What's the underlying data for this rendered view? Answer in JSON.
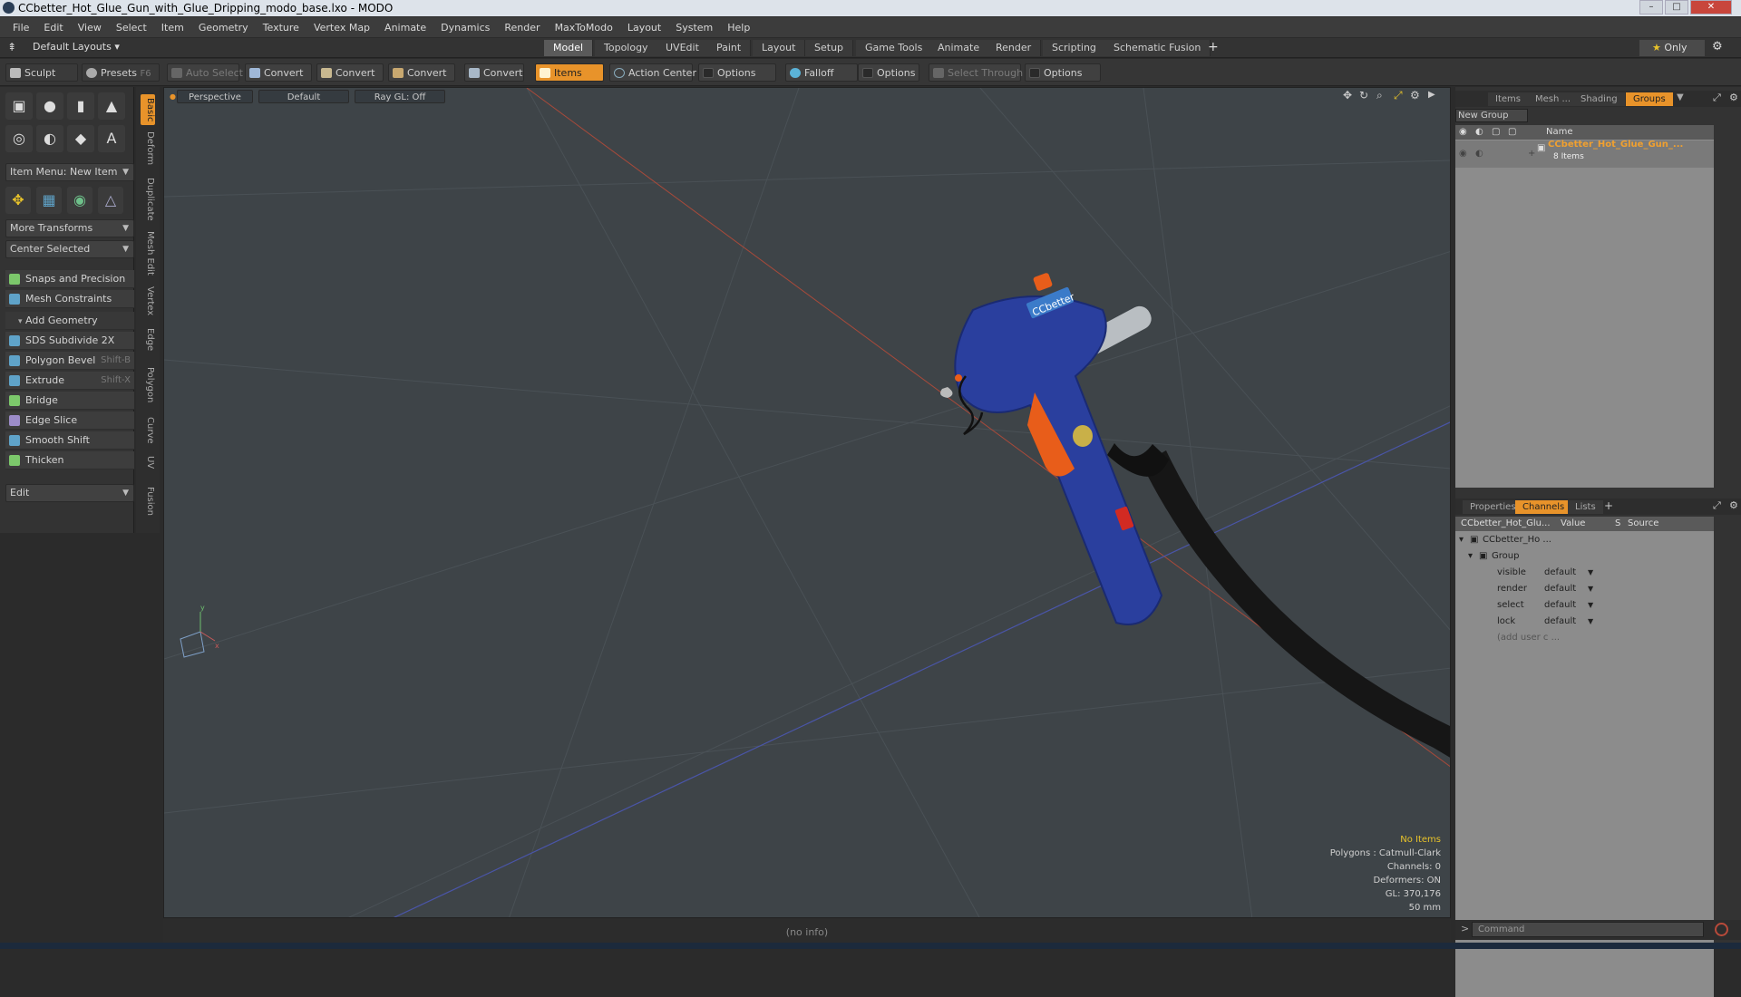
{
  "window": {
    "title": "CCbetter_Hot_Glue_Gun_with_Glue_Dripping_modo_base.lxo - MODO"
  },
  "menu": [
    "File",
    "Edit",
    "View",
    "Select",
    "Item",
    "Geometry",
    "Texture",
    "Vertex Map",
    "Animate",
    "Dynamics",
    "Render",
    "MaxToModo",
    "Layout",
    "System",
    "Help"
  ],
  "layout_bar": {
    "preset": "Default Layouts",
    "tabs": [
      "Model",
      "Topology",
      "UVEdit",
      "Paint",
      "Layout",
      "Setup",
      "Game Tools",
      "Animate",
      "Render",
      "Scripting",
      "Schematic Fusion"
    ],
    "active_tab": "Model",
    "only_label": "Only"
  },
  "toolbar": {
    "sculpt": "Sculpt",
    "presets": "Presets",
    "presets_shortcut": "F6",
    "auto_select": "Auto Select",
    "convert": "Convert",
    "items": "Items",
    "action_center": "Action Center",
    "options": "Options",
    "falloff": "Falloff",
    "select_through": "Select Through"
  },
  "left_panel": {
    "item_menu": "Item Menu: New Item",
    "more_transforms": "More Transforms",
    "center_selected": "Center Selected",
    "snaps": "Snaps and Precision",
    "mesh_constraints": "Mesh Constraints",
    "add_geometry": "Add Geometry",
    "tools": [
      {
        "label": "SDS Subdivide 2X",
        "shortcut": ""
      },
      {
        "label": "Polygon Bevel",
        "shortcut": "Shift-B"
      },
      {
        "label": "Extrude",
        "shortcut": "Shift-X"
      },
      {
        "label": "Bridge",
        "shortcut": ""
      },
      {
        "label": "Edge Slice",
        "shortcut": ""
      },
      {
        "label": "Smooth Shift",
        "shortcut": ""
      },
      {
        "label": "Thicken",
        "shortcut": ""
      }
    ],
    "edit": "Edit",
    "vertical_tabs": [
      "Basic",
      "Deform",
      "Duplicate",
      "Mesh Edit",
      "Vertex",
      "Edge",
      "Polygon",
      "Curve",
      "UV",
      "Fusion"
    ]
  },
  "viewport": {
    "view": "Perspective",
    "shading": "Default",
    "raygl": "Ray GL: Off",
    "stats": {
      "items": "No Items",
      "polygons": "Polygons : Catmull-Clark",
      "channels": "Channels: 0",
      "deformers": "Deformers: ON",
      "gl": "GL: 370,176",
      "focal": "50 mm"
    },
    "model_label": "CCbetter",
    "status": "(no info)"
  },
  "right_panel": {
    "top_tabs": [
      "Items",
      "Mesh ...",
      "Shading",
      "Groups"
    ],
    "active_top": "Groups",
    "new_group": "New Group",
    "name_col": "Name",
    "group_name": "CCbetter_Hot_Glue_Gun_...",
    "group_count": "8 Items",
    "bottom_tabs": [
      "Properties",
      "Channels",
      "Lists"
    ],
    "active_bottom": "Channels",
    "channel_cols": [
      "CCbetter_Hot_Glu...",
      "Value",
      "S",
      "Source"
    ],
    "tree_root": "CCbetter_Ho ...",
    "tree_group": "Group",
    "channels": [
      {
        "name": "visible",
        "value": "default"
      },
      {
        "name": "render",
        "value": "default"
      },
      {
        "name": "select",
        "value": "default"
      },
      {
        "name": "lock",
        "value": "default"
      }
    ],
    "add_user": "(add user c ...",
    "command_placeholder": "Command"
  },
  "colors": {
    "accent": "#e8932a",
    "viewport_bg": "#3e4448",
    "gun_blue": "#2a3f9e",
    "trigger_orange": "#e85d1a"
  }
}
